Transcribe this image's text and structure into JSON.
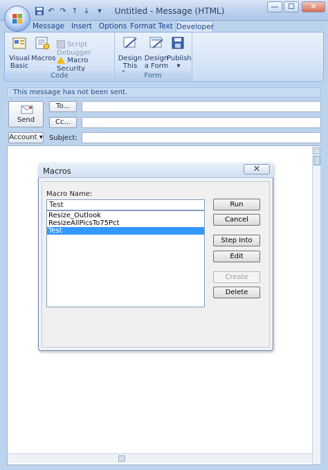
{
  "window": {
    "title": "Untitled - Message (HTML)",
    "controls": {
      "minimize": "—",
      "maximize": "☐",
      "close": "✕"
    }
  },
  "quick_access": [
    {
      "icon": "save-icon",
      "glyph": "💾"
    },
    {
      "icon": "undo-icon",
      "glyph": "↶"
    },
    {
      "icon": "redo-icon",
      "glyph": "↷"
    },
    {
      "icon": "up-arrow-icon",
      "glyph": "↑"
    },
    {
      "icon": "down-arrow-icon",
      "glyph": "↓"
    },
    {
      "icon": "customize-qat-icon",
      "glyph": "▾"
    }
  ],
  "tabs": [
    "Message",
    "Insert",
    "Options",
    "Format Text",
    "Developer"
  ],
  "active_tab": "Developer",
  "ribbon": {
    "code_group": {
      "label": "Code",
      "visual_basic": "Visual\nBasic",
      "visual_basic_l1": "Visual",
      "visual_basic_l2": "Basic",
      "macros": "Macros",
      "script_debugger": "Script Debugger",
      "macro_security": "Macro Security"
    },
    "form_group": {
      "label": "Form",
      "design_this_form_l1": "Design",
      "design_this_form_l2": "This Form",
      "design_a_form_l1": "Design",
      "design_a_form_l2": "a Form",
      "publish": "Publish",
      "publish_arrow": "▾"
    }
  },
  "compose": {
    "info": "This message has not been sent.",
    "send": "Send",
    "to": "To...",
    "cc": "Cc...",
    "account": "Account",
    "account_arrow": "▾",
    "subject": "Subject:"
  },
  "dialog": {
    "title": "Macros",
    "close": "✕",
    "macro_name_label": "Macro Name:",
    "macro_name_value": "Test",
    "macros": [
      "Resize_Outlook",
      "ResizeAllPicsTo75Pct",
      "Test"
    ],
    "selected_index": 2,
    "buttons": {
      "run": "Run",
      "cancel": "Cancel",
      "step_into": "Step Into",
      "edit": "Edit",
      "create": "Create",
      "delete": "Delete"
    }
  },
  "colors": {
    "selection": "#3399ff",
    "ribbon_text": "#15428b"
  }
}
